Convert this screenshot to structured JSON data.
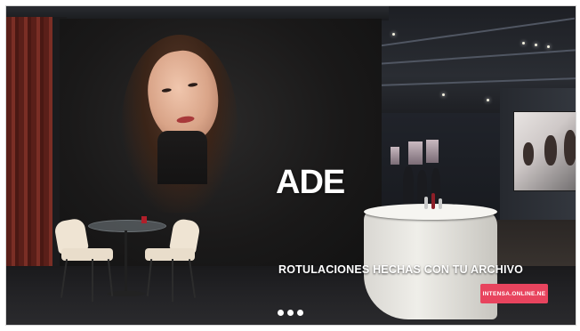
{
  "slide": {
    "brand": "ADE",
    "tagline": "ROTULACIONES HECHAS CON TU ARCHIVO",
    "cta_label": "INTENSA.ONLINE.NE"
  },
  "carousel": {
    "dots": [
      "slide-1",
      "slide-2",
      "slide-3"
    ],
    "active_index": 0
  },
  "colors": {
    "cta_background": "#e8445e",
    "text": "#ffffff",
    "stand_wall": "#1a1919",
    "counter": "#efeee9"
  }
}
